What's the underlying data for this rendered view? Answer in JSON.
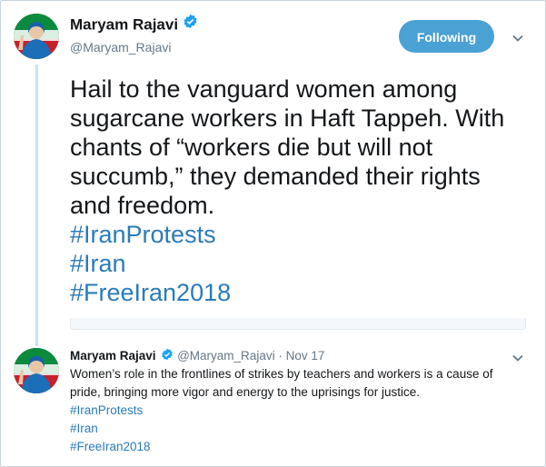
{
  "main_tweet": {
    "author_name": "Maryam Rajavi",
    "handle": "@Maryam_Rajavi",
    "follow_label": "Following",
    "text": "Hail to the vanguard women among sugarcane workers in Haft Tappeh. With chants of “workers die but will not succumb,” they demanded their rights and freedom.",
    "hashtags": [
      "#IranProtests",
      "#Iran",
      "#FreeIran2018"
    ],
    "icons": {
      "verified": "verified-badge-icon",
      "menu": "chevron-down-icon"
    }
  },
  "quoted_tweet": {
    "author_name": "Maryam Rajavi",
    "handle": "@Maryam_Rajavi",
    "separator": "·",
    "date": "Nov 17",
    "text": "Women’s role in the frontlines of strikes by teachers and workers is a cause of pride, bringing more vigor and energy to the uprisings for justice.",
    "hashtags": [
      "#IranProtests",
      "#Iran",
      "#FreeIran2018"
    ]
  },
  "colors": {
    "accent": "#1da1f2",
    "follow_button": "#4aa1d3",
    "link": "#2b7bb9",
    "thread_line": "#c7e4f2",
    "text": "#14171a",
    "muted": "#657786"
  }
}
